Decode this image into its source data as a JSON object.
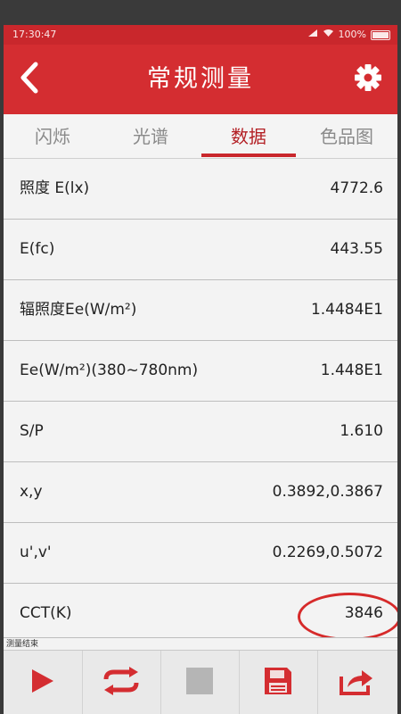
{
  "status_bar": {
    "time": "17:30:47",
    "battery": "100%"
  },
  "header": {
    "title": "常规测量"
  },
  "tabs": [
    {
      "label": "闪烁",
      "active": false
    },
    {
      "label": "光谱",
      "active": false
    },
    {
      "label": "数据",
      "active": true
    },
    {
      "label": "色品图",
      "active": false
    }
  ],
  "rows": [
    {
      "label": "照度 E(lx)",
      "value": "4772.6"
    },
    {
      "label": "E(fc)",
      "value": "443.55"
    },
    {
      "label": "辐照度Ee(W/m²)",
      "value": "1.4484E1"
    },
    {
      "label": "Ee(W/m²)(380~780nm)",
      "value": "1.448E1"
    },
    {
      "label": "S/P",
      "value": "1.610"
    },
    {
      "label": "x,y",
      "value": "0.3892,0.3867"
    },
    {
      "label": "u',v'",
      "value": "0.2269,0.5072"
    },
    {
      "label": "CCT(K)",
      "value": "3846"
    }
  ],
  "status_message": "测量结束",
  "toolbar": {
    "icons": [
      "play-icon",
      "repeat-icon",
      "stop-icon",
      "save-icon",
      "share-icon"
    ]
  },
  "colors": {
    "accent": "#d42d31",
    "toolbar_icon": "#d42d31",
    "disabled_icon": "#b5b5b5"
  }
}
